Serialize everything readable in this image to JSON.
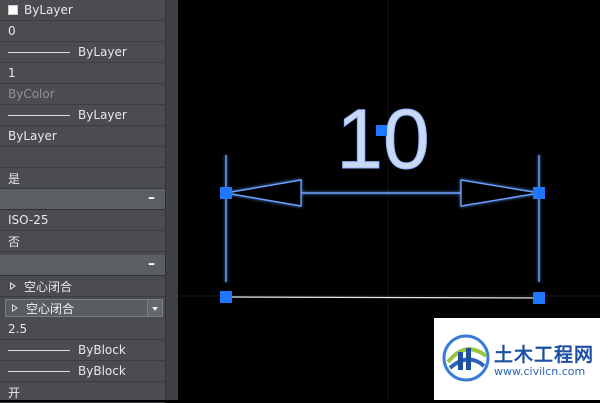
{
  "properties": {
    "rows": [
      {
        "value": "ByLayer"
      },
      {
        "value": "0"
      },
      {
        "value": "ByLayer"
      },
      {
        "value": "1"
      },
      {
        "value": "ByColor"
      },
      {
        "value": "ByLayer"
      },
      {
        "value": "ByLayer"
      },
      {
        "value": ""
      },
      {
        "value": "是"
      },
      {
        "value": "ISO-25"
      },
      {
        "value": "否"
      },
      {
        "value": "空心闭合"
      },
      {
        "value": "空心闭合"
      },
      {
        "value": "2.5"
      },
      {
        "value": "ByBlock"
      },
      {
        "value": "ByBlock"
      },
      {
        "value": "开"
      }
    ],
    "collapse_symbol": "–"
  },
  "drawing": {
    "dimension_text": "10",
    "dimension_color": "#c9d9f3",
    "grip_color": "#1e78ff"
  },
  "watermark": {
    "name": "土木工程网",
    "url": "www.civilcn.com"
  }
}
